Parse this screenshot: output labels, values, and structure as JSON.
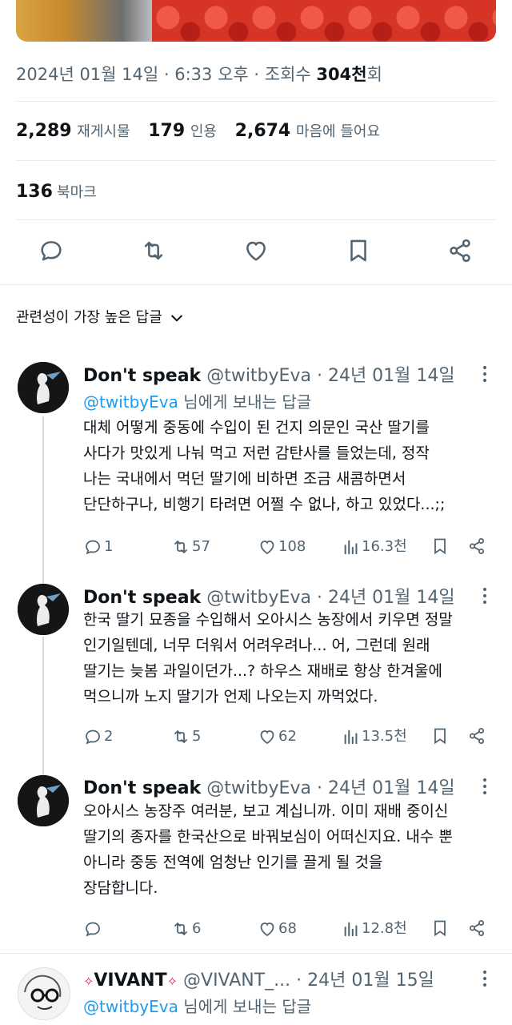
{
  "tweet": {
    "date": "2024년 01월 14일",
    "time": "6:33 오후",
    "views_label": "조회수",
    "views_count": "304천",
    "views_suffix": "회",
    "reposts": "2,289",
    "reposts_label": "재게시물",
    "quotes": "179",
    "quotes_label": "인용",
    "likes": "2,674",
    "likes_label": "마음에 들어요",
    "bookmarks": "136",
    "bookmarks_label": "북마크"
  },
  "actions": [
    "reply-icon",
    "repost-icon",
    "like-icon",
    "bookmark-icon",
    "share-icon"
  ],
  "sort": {
    "label": "관련성이 가장 높은 답글"
  },
  "replies": [
    {
      "name": "Don't speak",
      "handle": "@twitbyEva",
      "date": "24년 01월 14일",
      "reply_to_handle": "@twitbyEva",
      "reply_to_suffix": "님에게 보내는 답글",
      "lines": [
        "대체 어떻게 중동에 수입이 된 건지 의문인 국산 딸기를",
        "사다가 맛있게 나눠 먹고 저런 감탄사를 들었는데, 정작",
        "나는 국내에서 먹던 딸기에 비하면 조금 새콤하면서",
        "단단하구나, 비행기 타려면 어쩔 수 없나, 하고 있었다...;;"
      ],
      "reply_count": "1",
      "repost_count": "57",
      "like_count": "108",
      "view_count": "16.3천"
    },
    {
      "name": "Don't speak",
      "handle": "@twitbyEva",
      "date": "24년 01월 14일",
      "lines": [
        "한국 딸기 묘종을 수입해서 오아시스 농장에서 키우면 정말",
        "인기일텐데, 너무 더워서 어려우려나... 어, 그런데 원래",
        "딸기는 늦봄 과일이던가...? 하우스 재배로 항상 한겨울에",
        "먹으니까 노지 딸기가 언제 나오는지 까먹었다."
      ],
      "reply_count": "2",
      "repost_count": "5",
      "like_count": "62",
      "view_count": "13.5천"
    },
    {
      "name": "Don't speak",
      "handle": "@twitbyEva",
      "date": "24년 01월 14일",
      "lines": [
        "오아시스 농장주 여러분, 보고 계십니까. 이미 재배 중이신",
        "딸기의 종자를 한국산으로 바꿔보심이 어떠신지요. 내수 뿐",
        "아니라 중동 전역에 엄청난 인기를 끌게 될 것을",
        "장담합니다."
      ],
      "reply_count": "",
      "repost_count": "6",
      "like_count": "68",
      "view_count": "12.8천"
    },
    {
      "name": "VIVANT",
      "handle": "@VIVANT_...",
      "date": "24년 01월 15일",
      "reply_to_handle": "@twitbyEva",
      "reply_to_suffix": "님에게 보내는 답글"
    }
  ],
  "colors": {
    "text": "#0f1419",
    "muted": "#536471",
    "link": "#1d9bf0",
    "divider": "#e6ecf0",
    "accent_red": "#e0245e"
  }
}
